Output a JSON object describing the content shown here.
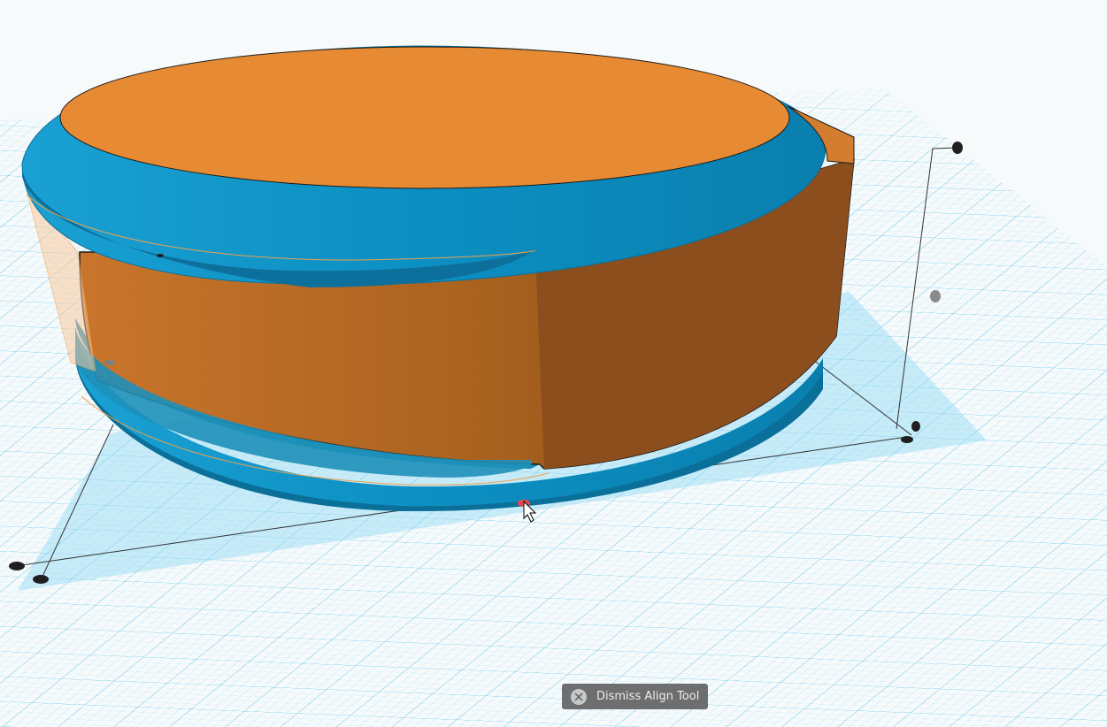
{
  "app": {
    "view": "3D Workplane"
  },
  "workplane": {
    "grid_color": "#53c3ea",
    "background": "#f7fafb",
    "highlight_color": "#a8e2f5"
  },
  "objects": [
    {
      "name": "orange-cylinder",
      "color": "#e68a33",
      "role": "selected shape"
    },
    {
      "name": "blue-ring",
      "color": "#0b8cc0",
      "role": "ring shape"
    }
  ],
  "align_tool": {
    "handle_color": "#1f1f1f",
    "active_handle_color": "#f0454f",
    "dismiss_label": "Dismiss Align Tool",
    "dismiss_icon": "close-icon"
  },
  "cursor": {
    "icon": "arrow-cursor-icon"
  }
}
